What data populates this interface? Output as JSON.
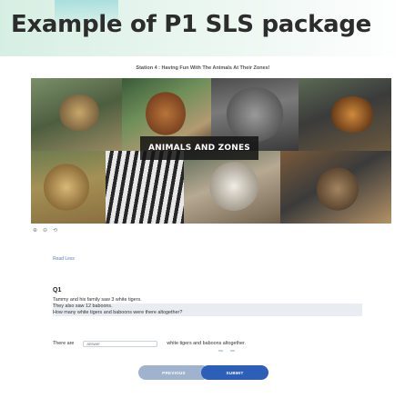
{
  "page": {
    "title": "Example of P1 SLS package"
  },
  "slide": {
    "station_caption": "Station 4 : Having Fun With The Animals At Their Zones!",
    "banner_label": "ANIMALS AND ZONES",
    "tiles": [
      {
        "name": "Lion",
        "caption": ""
      },
      {
        "name": "Orangutan",
        "caption": ""
      },
      {
        "name": "Elephant",
        "caption": ""
      },
      {
        "name": "Sumatran Tiger",
        "caption": ""
      },
      {
        "name": "Cheetah",
        "caption": ""
      },
      {
        "name": "Zebra",
        "caption": ""
      },
      {
        "name": "White Tiger",
        "caption": ""
      },
      {
        "name": "Baboons",
        "caption": ""
      }
    ],
    "thumb_icons": [
      "⊕",
      "⊖",
      "⟲"
    ]
  },
  "worksheet": {
    "read_less": "Read Less",
    "question_label": "Q1",
    "lines": [
      "Tammy and his family saw 3 white tigers.",
      "They also saw 12 baboons.",
      "How many white tigers and baboons were there altogether?"
    ],
    "answer_prefix": "There are",
    "answer_placeholder": "answer",
    "answer_suffix": "white tigers and baboons altogether.",
    "prev_label": "PREVIOUS",
    "submit_label": "SUBMIT"
  }
}
